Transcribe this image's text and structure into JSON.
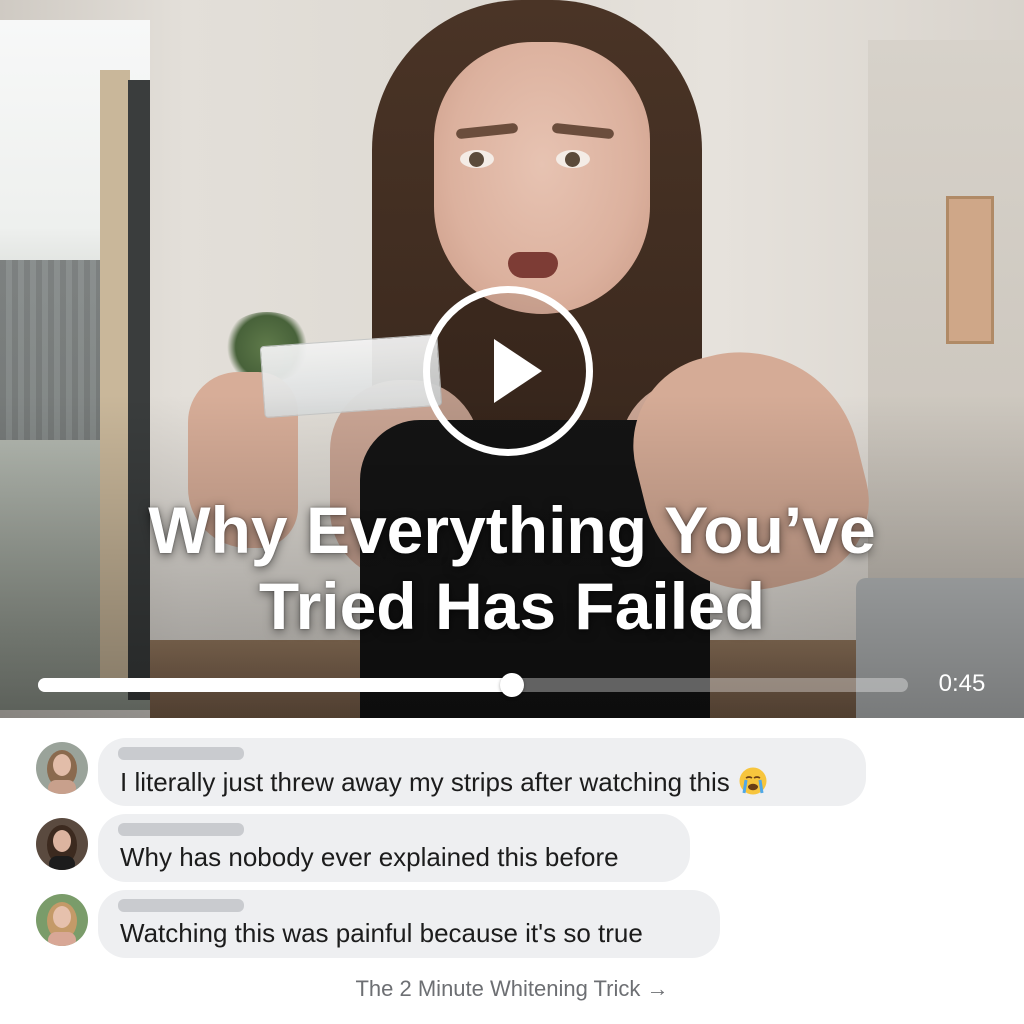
{
  "video": {
    "title_lines": [
      "Why Everything You’ve",
      "Tried Has Failed"
    ],
    "time": "0:45",
    "progress": 0.545,
    "play_icon": "play-icon"
  },
  "comments": [
    {
      "text": "I literally just threw away my strips after watching this",
      "emoji": "crying-face-emoji"
    },
    {
      "text": "Why has nobody ever explained this before"
    },
    {
      "text": "Watching this was painful because it's so true"
    }
  ],
  "cta": {
    "label": "The 2 Minute Whitening Trick →"
  }
}
